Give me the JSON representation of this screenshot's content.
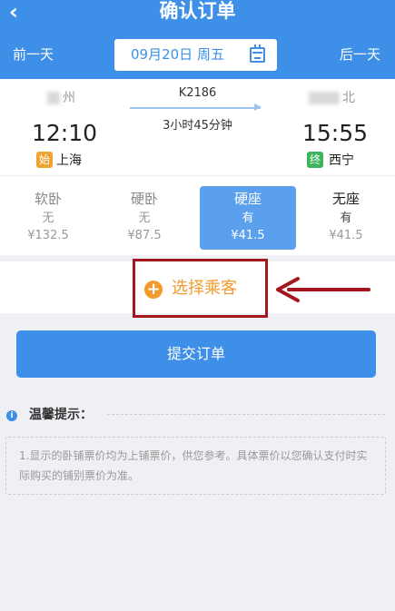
{
  "header": {
    "back_icon": "chevron-left-icon",
    "title": "确认订单"
  },
  "datebar": {
    "prev_label": "前一天",
    "date": "09月20日 周五",
    "calendar_icon": "calendar-icon",
    "next_label": "后一天"
  },
  "train": {
    "from_station_partial": "州",
    "to_station_partial": "北",
    "number": "K2186",
    "duration": "3小时45分钟",
    "depart_time": "12:10",
    "arrive_time": "15:55",
    "start_badge": "始",
    "start_station": "上海",
    "end_badge": "终",
    "end_station": "西宁"
  },
  "seats": [
    {
      "name": "软卧",
      "availability": "无",
      "price": "¥132.5"
    },
    {
      "name": "硬卧",
      "availability": "无",
      "price": "¥87.5"
    },
    {
      "name": "硬座",
      "availability": "有",
      "price": "¥41.5"
    },
    {
      "name": "无座",
      "availability": "有",
      "price": "¥41.5"
    }
  ],
  "colors": {
    "brand": "#3d8fe8",
    "accent": "#f29a2e",
    "highlight_box": "#a4161e"
  },
  "passenger": {
    "add_icon": "plus-circle-icon",
    "label": "选择乘客"
  },
  "submit_label": "提交订单",
  "tips": {
    "icon": "info-icon",
    "title": "温馨提示：",
    "text": "1.显示的卧铺票价均为上铺票价，供您参考。具体票价以您确认支付时实际购买的铺别票价为准。"
  }
}
